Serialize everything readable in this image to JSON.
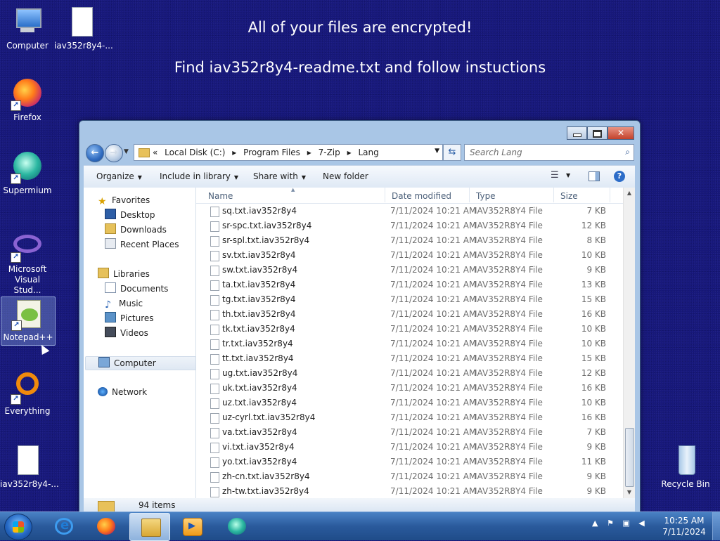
{
  "banner": {
    "line1": "All of your files are encrypted!",
    "line2": "Find iav352r8y4-readme.txt and follow instuctions"
  },
  "desktop_icons": [
    {
      "label": "Computer",
      "icon": "computer-icon"
    },
    {
      "label": "iav352r8y4-...",
      "icon": "text-file-icon"
    },
    {
      "label": "Firefox",
      "icon": "firefox-icon"
    },
    {
      "label": "Supermium",
      "icon": "supermium-icon"
    },
    {
      "label": "Microsoft Visual Stud...",
      "icon": "visual-studio-icon"
    },
    {
      "label": "Notepad++",
      "icon": "notepadpp-icon"
    },
    {
      "label": "Everything",
      "icon": "everything-icon"
    },
    {
      "label": "iav352r8y4-...",
      "icon": "text-file-icon"
    },
    {
      "label": "Recycle Bin",
      "icon": "recycle-bin-icon"
    }
  ],
  "explorer": {
    "breadcrumb": [
      "«",
      "Local Disk (C:)",
      "▸",
      "Program Files",
      "▸",
      "7-Zip",
      "▸",
      "Lang"
    ],
    "search_placeholder": "Search Lang",
    "toolbar": {
      "organize": "Organize",
      "include": "Include in library",
      "share": "Share with",
      "new_folder": "New folder"
    },
    "nav": {
      "favorites": "Favorites",
      "desktop": "Desktop",
      "downloads": "Downloads",
      "recent": "Recent Places",
      "libraries": "Libraries",
      "documents": "Documents",
      "music": "Music",
      "pictures": "Pictures",
      "videos": "Videos",
      "computer": "Computer",
      "network": "Network"
    },
    "columns": {
      "name": "Name",
      "date": "Date modified",
      "type": "Type",
      "size": "Size"
    },
    "files": [
      {
        "name": "sq.txt.iav352r8y4",
        "date": "7/11/2024 10:21 AM",
        "type": "IAV352R8Y4 File",
        "size": "7 KB"
      },
      {
        "name": "sr-spc.txt.iav352r8y4",
        "date": "7/11/2024 10:21 AM",
        "type": "IAV352R8Y4 File",
        "size": "12 KB"
      },
      {
        "name": "sr-spl.txt.iav352r8y4",
        "date": "7/11/2024 10:21 AM",
        "type": "IAV352R8Y4 File",
        "size": "8 KB"
      },
      {
        "name": "sv.txt.iav352r8y4",
        "date": "7/11/2024 10:21 AM",
        "type": "IAV352R8Y4 File",
        "size": "10 KB"
      },
      {
        "name": "sw.txt.iav352r8y4",
        "date": "7/11/2024 10:21 AM",
        "type": "IAV352R8Y4 File",
        "size": "9 KB"
      },
      {
        "name": "ta.txt.iav352r8y4",
        "date": "7/11/2024 10:21 AM",
        "type": "IAV352R8Y4 File",
        "size": "13 KB"
      },
      {
        "name": "tg.txt.iav352r8y4",
        "date": "7/11/2024 10:21 AM",
        "type": "IAV352R8Y4 File",
        "size": "15 KB"
      },
      {
        "name": "th.txt.iav352r8y4",
        "date": "7/11/2024 10:21 AM",
        "type": "IAV352R8Y4 File",
        "size": "16 KB"
      },
      {
        "name": "tk.txt.iav352r8y4",
        "date": "7/11/2024 10:21 AM",
        "type": "IAV352R8Y4 File",
        "size": "10 KB"
      },
      {
        "name": "tr.txt.iav352r8y4",
        "date": "7/11/2024 10:21 AM",
        "type": "IAV352R8Y4 File",
        "size": "10 KB"
      },
      {
        "name": "tt.txt.iav352r8y4",
        "date": "7/11/2024 10:21 AM",
        "type": "IAV352R8Y4 File",
        "size": "15 KB"
      },
      {
        "name": "ug.txt.iav352r8y4",
        "date": "7/11/2024 10:21 AM",
        "type": "IAV352R8Y4 File",
        "size": "12 KB"
      },
      {
        "name": "uk.txt.iav352r8y4",
        "date": "7/11/2024 10:21 AM",
        "type": "IAV352R8Y4 File",
        "size": "16 KB"
      },
      {
        "name": "uz.txt.iav352r8y4",
        "date": "7/11/2024 10:21 AM",
        "type": "IAV352R8Y4 File",
        "size": "10 KB"
      },
      {
        "name": "uz-cyrl.txt.iav352r8y4",
        "date": "7/11/2024 10:21 AM",
        "type": "IAV352R8Y4 File",
        "size": "16 KB"
      },
      {
        "name": "va.txt.iav352r8y4",
        "date": "7/11/2024 10:21 AM",
        "type": "IAV352R8Y4 File",
        "size": "7 KB"
      },
      {
        "name": "vi.txt.iav352r8y4",
        "date": "7/11/2024 10:21 AM",
        "type": "IAV352R8Y4 File",
        "size": "9 KB"
      },
      {
        "name": "yo.txt.iav352r8y4",
        "date": "7/11/2024 10:21 AM",
        "type": "IAV352R8Y4 File",
        "size": "11 KB"
      },
      {
        "name": "zh-cn.txt.iav352r8y4",
        "date": "7/11/2024 10:21 AM",
        "type": "IAV352R8Y4 File",
        "size": "9 KB"
      },
      {
        "name": "zh-tw.txt.iav352r8y4",
        "date": "7/11/2024 10:21 AM",
        "type": "IAV352R8Y4 File",
        "size": "9 KB"
      }
    ],
    "status_count": "94 items"
  },
  "taskbar": {
    "apps": [
      {
        "icon": "internet-explorer-icon"
      },
      {
        "icon": "firefox-icon"
      },
      {
        "icon": "file-explorer-icon"
      },
      {
        "icon": "media-player-icon"
      },
      {
        "icon": "supermium-icon"
      }
    ],
    "clock_time": "10:25 AM",
    "clock_date": "7/11/2024"
  },
  "colors": {
    "desktop": "#17187a",
    "window_frame": "#a9c6e6",
    "taskbar": "#2a5a9c"
  }
}
